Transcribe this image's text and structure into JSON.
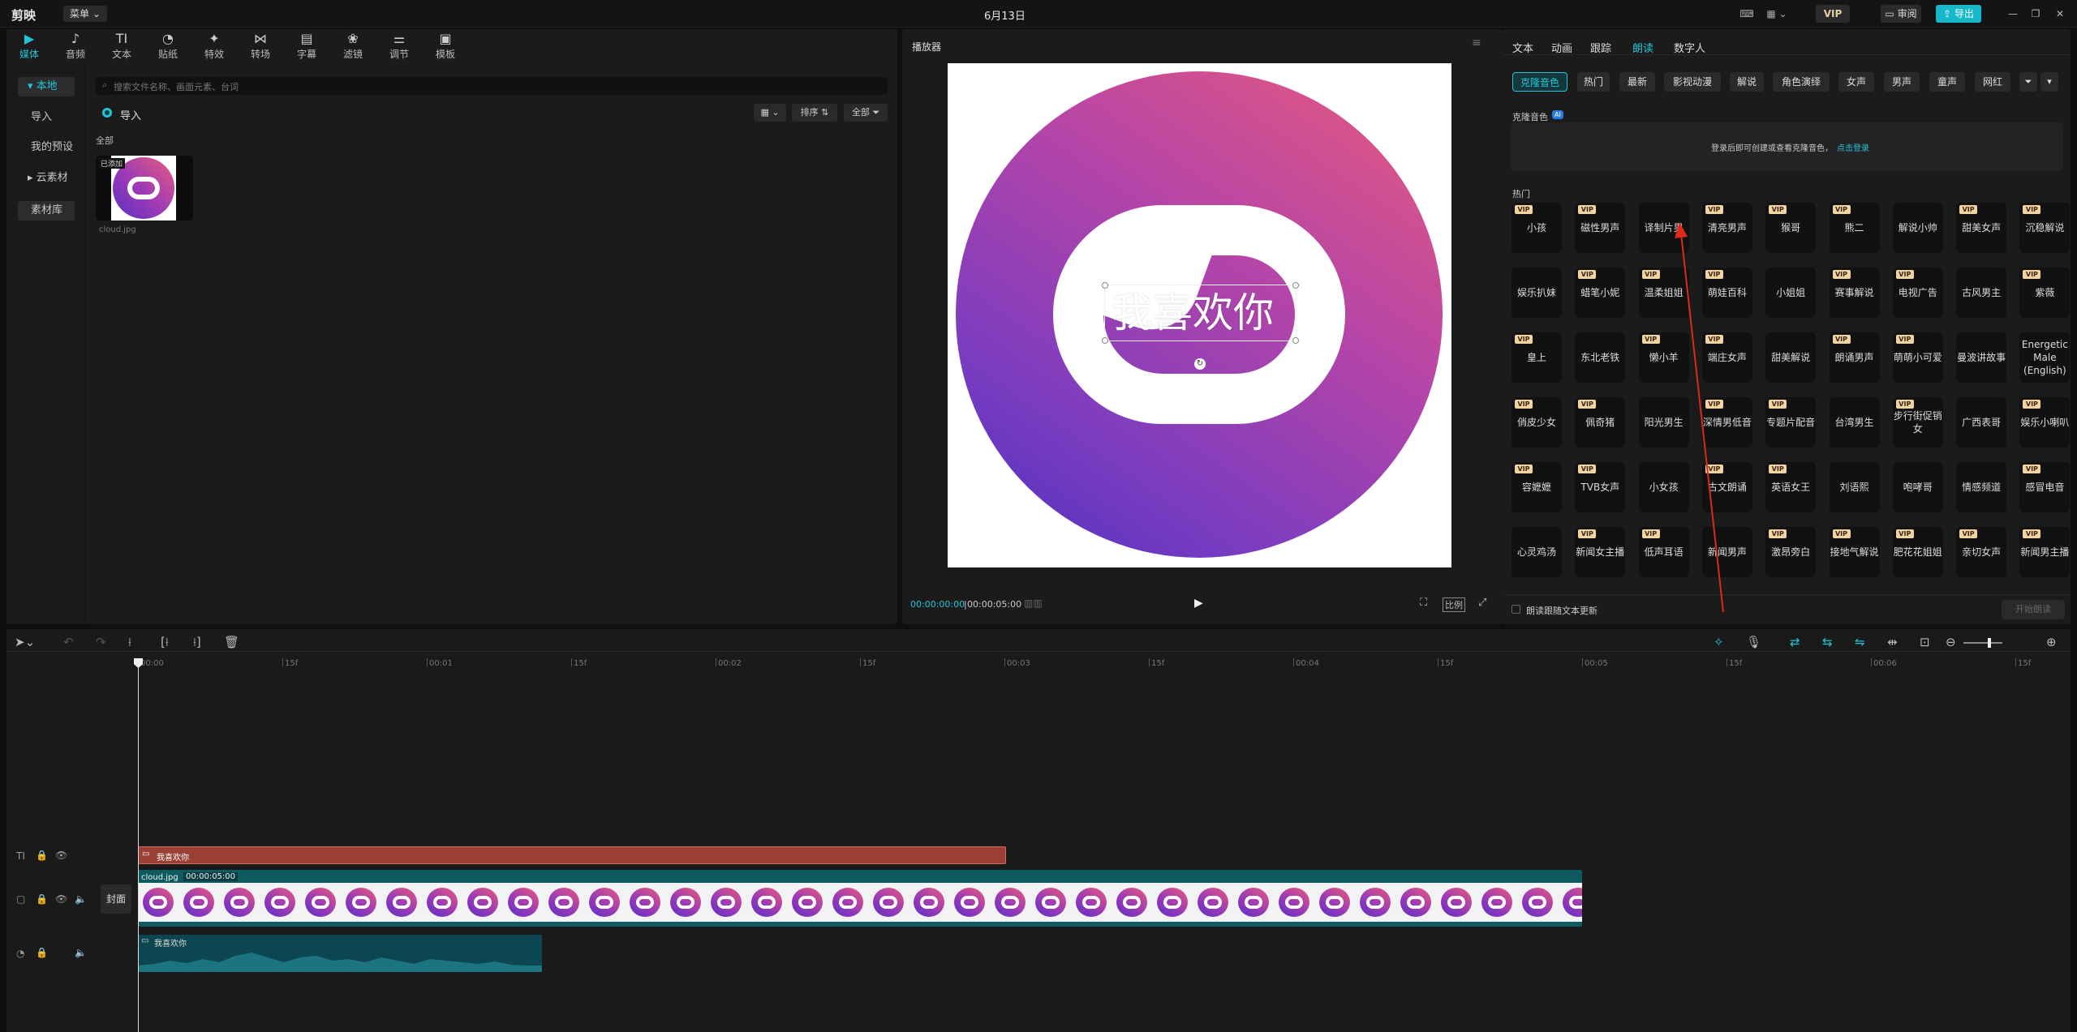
{
  "app": {
    "logo": "剪映",
    "menu_label": "菜单",
    "title": "6月13日",
    "vip_label": "VIP",
    "review_label": "审阅",
    "export_label": "导出"
  },
  "media_toolbar": [
    {
      "label": "媒体",
      "icon": "media-icon",
      "glyph": "▶"
    },
    {
      "label": "音频",
      "icon": "audio-icon",
      "glyph": "♪"
    },
    {
      "label": "文本",
      "icon": "text-icon",
      "glyph": "TI"
    },
    {
      "label": "贴纸",
      "icon": "sticker-icon",
      "glyph": "◔"
    },
    {
      "label": "特效",
      "icon": "effects-icon",
      "glyph": "✦"
    },
    {
      "label": "转场",
      "icon": "transition-icon",
      "glyph": "⋈"
    },
    {
      "label": "字幕",
      "icon": "subtitle-icon",
      "glyph": "▤"
    },
    {
      "label": "滤镜",
      "icon": "filter-icon",
      "glyph": "❀"
    },
    {
      "label": "调节",
      "icon": "adjust-icon",
      "glyph": "⚌"
    },
    {
      "label": "模板",
      "icon": "template-icon",
      "glyph": "▣"
    }
  ],
  "media_sidebar": {
    "local": "本地",
    "import": "导入",
    "presets": "我的预设",
    "cloud": "云素材",
    "library": "素材库"
  },
  "media_main": {
    "search_placeholder": "搜索文件名称、画面元素、台词",
    "import_label": "导入",
    "sort_label": "排序",
    "filter_label": "全部",
    "section_label": "全部",
    "asset_badge": "已添加",
    "asset_name": "cloud.jpg"
  },
  "player": {
    "title": "播放器",
    "overlay_text": "我喜欢你",
    "current_time": "00:00:00:00",
    "total_time": "00:00:05:00",
    "ratio_label": "比例"
  },
  "right_panel": {
    "tabs": [
      "文本",
      "动画",
      "跟踪",
      "朗读",
      "数字人"
    ],
    "active_tab": "朗读",
    "chips": [
      "克隆音色",
      "热门",
      "最新",
      "影视动漫",
      "解说",
      "角色演绎",
      "女声",
      "男声",
      "童声",
      "网红"
    ],
    "clone_label": "克隆音色",
    "ai_badge": "AI",
    "clone_hint": "登录后即可创建或查看克隆音色，",
    "clone_link": "点击登录",
    "hot_label": "热门",
    "voices": [
      {
        "name": "小孩",
        "vip": true
      },
      {
        "name": "磁性男声",
        "vip": true
      },
      {
        "name": "译制片男",
        "vip": false
      },
      {
        "name": "清亮男声",
        "vip": true
      },
      {
        "name": "猴哥",
        "vip": true
      },
      {
        "name": "熊二",
        "vip": true
      },
      {
        "name": "解说小帅",
        "vip": false
      },
      {
        "name": "甜美女声",
        "vip": true
      },
      {
        "name": "沉稳解说",
        "vip": true
      },
      {
        "name": "娱乐扒妹",
        "vip": false
      },
      {
        "name": "蜡笔小妮",
        "vip": true
      },
      {
        "name": "温柔姐姐",
        "vip": true
      },
      {
        "name": "萌娃百科",
        "vip": true
      },
      {
        "name": "小姐姐",
        "vip": false
      },
      {
        "name": "赛事解说",
        "vip": true
      },
      {
        "name": "电视广告",
        "vip": true
      },
      {
        "name": "古风男主",
        "vip": false
      },
      {
        "name": "紫薇",
        "vip": true
      },
      {
        "name": "皇上",
        "vip": true
      },
      {
        "name": "东北老铁",
        "vip": false
      },
      {
        "name": "懒小羊",
        "vip": true
      },
      {
        "name": "端庄女声",
        "vip": true
      },
      {
        "name": "甜美解说",
        "vip": false
      },
      {
        "name": "朗诵男声",
        "vip": true
      },
      {
        "name": "萌萌小可爱",
        "vip": true
      },
      {
        "name": "曼波讲故事",
        "vip": false
      },
      {
        "name": "Energetic Male (English)",
        "vip": false
      },
      {
        "name": "俏皮少女",
        "vip": true
      },
      {
        "name": "佩奇猪",
        "vip": true
      },
      {
        "name": "阳光男生",
        "vip": false
      },
      {
        "name": "深情男低音",
        "vip": true
      },
      {
        "name": "专题片配音",
        "vip": true
      },
      {
        "name": "台湾男生",
        "vip": false
      },
      {
        "name": "步行街促销女",
        "vip": true
      },
      {
        "name": "广西表哥",
        "vip": false
      },
      {
        "name": "娱乐小喇叭",
        "vip": true
      },
      {
        "name": "容嬷嬷",
        "vip": true
      },
      {
        "name": "TVB女声",
        "vip": true
      },
      {
        "name": "小女孩",
        "vip": false
      },
      {
        "name": "古文朗诵",
        "vip": true
      },
      {
        "name": "英语女王",
        "vip": true
      },
      {
        "name": "刘语熙",
        "vip": false
      },
      {
        "name": "咆哮哥",
        "vip": false
      },
      {
        "name": "情感频道",
        "vip": false
      },
      {
        "name": "感冒电音",
        "vip": true
      },
      {
        "name": "心灵鸡汤",
        "vip": false
      },
      {
        "name": "新闻女主播",
        "vip": true
      },
      {
        "name": "低声耳语",
        "vip": true
      },
      {
        "name": "新闻男声",
        "vip": false
      },
      {
        "name": "激昂旁白",
        "vip": true
      },
      {
        "name": "接地气解说",
        "vip": true
      },
      {
        "name": "肥花花姐姐",
        "vip": true
      },
      {
        "name": "亲切女声",
        "vip": true
      },
      {
        "name": "新闻男主播",
        "vip": true
      }
    ],
    "follow_label": "朗读跟随文本更新",
    "start_label": "开始朗读"
  },
  "timeline": {
    "ruler": [
      "00:00",
      "15f",
      "00:01",
      "15f",
      "00:02",
      "15f",
      "00:03",
      "15f",
      "00:04",
      "15f",
      "00:05",
      "15f",
      "00:06",
      "15f"
    ],
    "text_clip": "我喜欢你",
    "video_clip_name": "cloud.jpg",
    "video_clip_duration": "00:00:05:00",
    "cover_label": "封面",
    "audio_clip": "我喜欢你"
  },
  "colors": {
    "accent": "#22c5d6",
    "text_clip": "#9b4035",
    "video_clip": "#0e5a61",
    "audio_clip": "#0c4650",
    "arrow": "#e0281c"
  }
}
